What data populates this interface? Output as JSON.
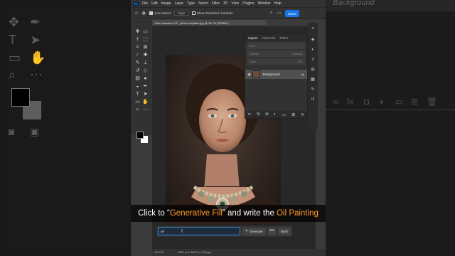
{
  "menu": {
    "logo": "Ps",
    "items": [
      "File",
      "Edit",
      "Image",
      "Layer",
      "Type",
      "Select",
      "Filter",
      "3D",
      "View",
      "Plugins",
      "Window",
      "Help"
    ]
  },
  "options_bar": {
    "auto_select_label": "Auto-Select",
    "layer_select_value": "Layer",
    "transform_label": "Show Transform Controls",
    "share_label": "Share"
  },
  "document": {
    "tab_title": "luke-braswell-oYF-_AkVk-unsplash.jpg @ 16.7% (RGB/8) *",
    "zoom": "16.67%",
    "size_info": "2400 px x 3627 px (72 ppi)"
  },
  "layers_panel": {
    "tabs": [
      "Layers",
      "Channels",
      "Paths"
    ],
    "kind_placeholder": "Kind",
    "blend_mode": "Normal",
    "opacity_label": "Opacity:",
    "lock_label": "Lock:",
    "fill_label": "Fill:",
    "layer_name": "Background"
  },
  "caption": {
    "prefix": "Click to “",
    "highlight1": "Generative Fill",
    "middle": "” and write the ",
    "highlight2": "Oil Painting"
  },
  "generative_fill": {
    "prompt_value": "oil",
    "generate_label": "Generate",
    "more_label": "•••",
    "back_label": "Back"
  },
  "background_panel": {
    "title": "Background"
  },
  "colors": {
    "accent_blue": "#1473e6",
    "caption_highlight": "#ff9b2b"
  }
}
